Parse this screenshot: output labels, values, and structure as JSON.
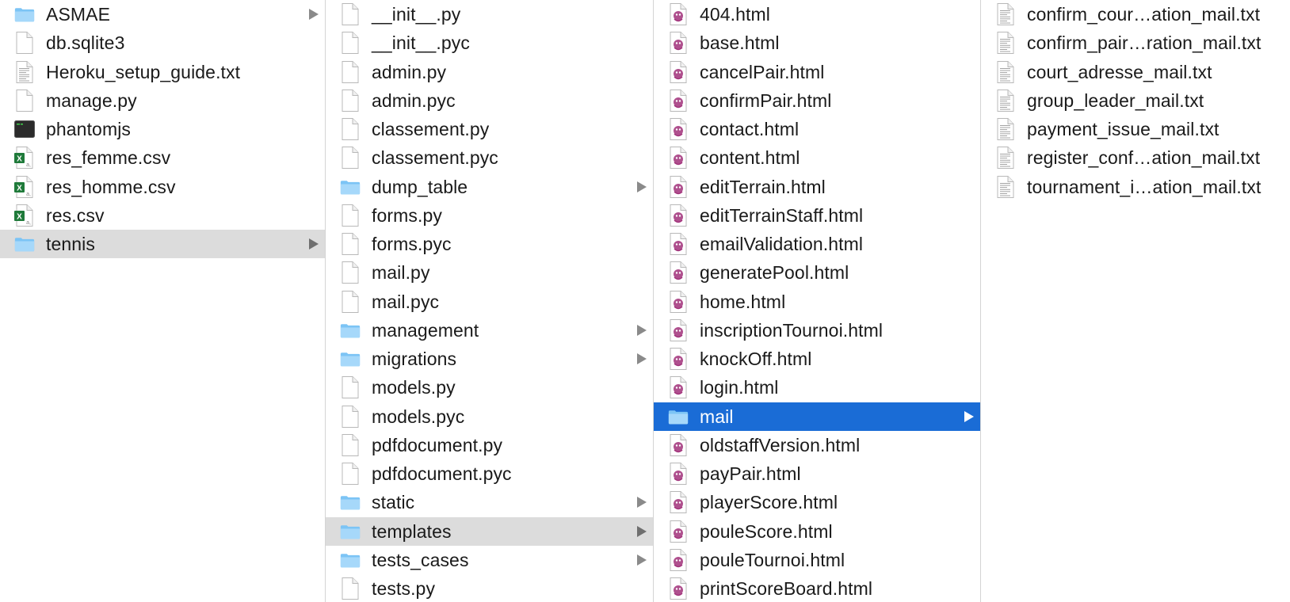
{
  "columns": [
    {
      "items": [
        {
          "name": "ASMAE",
          "kind": "folder",
          "expandable": true,
          "state": "none"
        },
        {
          "name": "db.sqlite3",
          "kind": "file",
          "expandable": false,
          "state": "none"
        },
        {
          "name": "Heroku_setup_guide.txt",
          "kind": "text",
          "expandable": false,
          "state": "none"
        },
        {
          "name": "manage.py",
          "kind": "file",
          "expandable": false,
          "state": "none"
        },
        {
          "name": "phantomjs",
          "kind": "exec",
          "expandable": false,
          "state": "none"
        },
        {
          "name": "res_femme.csv",
          "kind": "csv",
          "expandable": false,
          "state": "none"
        },
        {
          "name": "res_homme.csv",
          "kind": "csv",
          "expandable": false,
          "state": "none"
        },
        {
          "name": "res.csv",
          "kind": "csv",
          "expandable": false,
          "state": "none"
        },
        {
          "name": "tennis",
          "kind": "folder",
          "expandable": true,
          "state": "gray"
        }
      ]
    },
    {
      "items": [
        {
          "name": "__init__.py",
          "kind": "file",
          "expandable": false,
          "state": "none"
        },
        {
          "name": "__init__.pyc",
          "kind": "file",
          "expandable": false,
          "state": "none"
        },
        {
          "name": "admin.py",
          "kind": "file",
          "expandable": false,
          "state": "none"
        },
        {
          "name": "admin.pyc",
          "kind": "file",
          "expandable": false,
          "state": "none"
        },
        {
          "name": "classement.py",
          "kind": "file",
          "expandable": false,
          "state": "none"
        },
        {
          "name": "classement.pyc",
          "kind": "file",
          "expandable": false,
          "state": "none"
        },
        {
          "name": "dump_table",
          "kind": "folder",
          "expandable": true,
          "state": "none"
        },
        {
          "name": "forms.py",
          "kind": "file",
          "expandable": false,
          "state": "none"
        },
        {
          "name": "forms.pyc",
          "kind": "file",
          "expandable": false,
          "state": "none"
        },
        {
          "name": "mail.py",
          "kind": "file",
          "expandable": false,
          "state": "none"
        },
        {
          "name": "mail.pyc",
          "kind": "file",
          "expandable": false,
          "state": "none"
        },
        {
          "name": "management",
          "kind": "folder",
          "expandable": true,
          "state": "none"
        },
        {
          "name": "migrations",
          "kind": "folder",
          "expandable": true,
          "state": "none"
        },
        {
          "name": "models.py",
          "kind": "file",
          "expandable": false,
          "state": "none"
        },
        {
          "name": "models.pyc",
          "kind": "file",
          "expandable": false,
          "state": "none"
        },
        {
          "name": "pdfdocument.py",
          "kind": "file",
          "expandable": false,
          "state": "none"
        },
        {
          "name": "pdfdocument.pyc",
          "kind": "file",
          "expandable": false,
          "state": "none"
        },
        {
          "name": "static",
          "kind": "folder",
          "expandable": true,
          "state": "none"
        },
        {
          "name": "templates",
          "kind": "folder",
          "expandable": true,
          "state": "gray"
        },
        {
          "name": "tests_cases",
          "kind": "folder",
          "expandable": true,
          "state": "none"
        },
        {
          "name": "tests.py",
          "kind": "file",
          "expandable": false,
          "state": "none"
        }
      ]
    },
    {
      "items": [
        {
          "name": "404.html",
          "kind": "html",
          "expandable": false,
          "state": "none"
        },
        {
          "name": "base.html",
          "kind": "html",
          "expandable": false,
          "state": "none"
        },
        {
          "name": "cancelPair.html",
          "kind": "html",
          "expandable": false,
          "state": "none"
        },
        {
          "name": "confirmPair.html",
          "kind": "html",
          "expandable": false,
          "state": "none"
        },
        {
          "name": "contact.html",
          "kind": "html",
          "expandable": false,
          "state": "none"
        },
        {
          "name": "content.html",
          "kind": "html",
          "expandable": false,
          "state": "none"
        },
        {
          "name": "editTerrain.html",
          "kind": "html",
          "expandable": false,
          "state": "none"
        },
        {
          "name": "editTerrainStaff.html",
          "kind": "html",
          "expandable": false,
          "state": "none"
        },
        {
          "name": "emailValidation.html",
          "kind": "html",
          "expandable": false,
          "state": "none"
        },
        {
          "name": "generatePool.html",
          "kind": "html",
          "expandable": false,
          "state": "none"
        },
        {
          "name": "home.html",
          "kind": "html",
          "expandable": false,
          "state": "none"
        },
        {
          "name": "inscriptionTournoi.html",
          "kind": "html",
          "expandable": false,
          "state": "none"
        },
        {
          "name": "knockOff.html",
          "kind": "html",
          "expandable": false,
          "state": "none"
        },
        {
          "name": "login.html",
          "kind": "html",
          "expandable": false,
          "state": "none"
        },
        {
          "name": "mail",
          "kind": "folder",
          "expandable": true,
          "state": "blue"
        },
        {
          "name": "oldstaffVersion.html",
          "kind": "html",
          "expandable": false,
          "state": "none"
        },
        {
          "name": "payPair.html",
          "kind": "html",
          "expandable": false,
          "state": "none"
        },
        {
          "name": "playerScore.html",
          "kind": "html",
          "expandable": false,
          "state": "none"
        },
        {
          "name": "pouleScore.html",
          "kind": "html",
          "expandable": false,
          "state": "none"
        },
        {
          "name": "pouleTournoi.html",
          "kind": "html",
          "expandable": false,
          "state": "none"
        },
        {
          "name": "printScoreBoard.html",
          "kind": "html",
          "expandable": false,
          "state": "none"
        }
      ]
    },
    {
      "items": [
        {
          "name": "confirm_cour…ation_mail.txt",
          "kind": "text",
          "expandable": false,
          "state": "none"
        },
        {
          "name": "confirm_pair…ration_mail.txt",
          "kind": "text",
          "expandable": false,
          "state": "none"
        },
        {
          "name": "court_adresse_mail.txt",
          "kind": "text",
          "expandable": false,
          "state": "none"
        },
        {
          "name": "group_leader_mail.txt",
          "kind": "text",
          "expandable": false,
          "state": "none"
        },
        {
          "name": "payment_issue_mail.txt",
          "kind": "text",
          "expandable": false,
          "state": "none"
        },
        {
          "name": "register_conf…ation_mail.txt",
          "kind": "text",
          "expandable": false,
          "state": "none"
        },
        {
          "name": "tournament_i…ation_mail.txt",
          "kind": "text",
          "expandable": false,
          "state": "none"
        }
      ]
    }
  ],
  "colors": {
    "folder": "#7cc4f5",
    "folder_tab": "#a6d8fa",
    "selection_active": "#1a6cd6",
    "selection_inactive": "#dcdcdc",
    "html_icon_accent": "#a1317a",
    "csv_icon_accent": "#1f7a3a"
  }
}
